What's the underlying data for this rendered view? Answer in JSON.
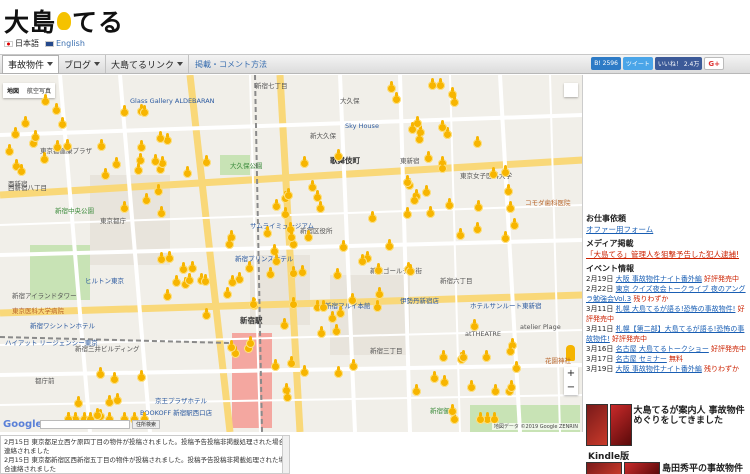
{
  "header": {
    "logo_text_1": "大島",
    "logo_text_2": "てる",
    "lang_ja": "日本語",
    "lang_en": "English"
  },
  "nav": {
    "items": [
      "事故物件",
      "ブログ",
      "大島てるリンク"
    ],
    "link": "掲載・コメント方法",
    "social": {
      "hatena": "B! 2596",
      "tweet": "ツイート",
      "like": "いいね！ 2.4万",
      "gplus": "G+"
    }
  },
  "map": {
    "type_map": "地図",
    "type_sat": "航空写真",
    "google": "Google",
    "attribution": "地図データ ©2019 Google ZENRIN",
    "search_btn": "住所検索",
    "labels": [
      {
        "t": "Glass Gallery ALDEBARAN",
        "c": "blue"
      },
      {
        "t": "西新宿",
        "c": ""
      },
      {
        "t": "東京都庁",
        "c": ""
      },
      {
        "t": "新宿中央公園",
        "c": "green"
      },
      {
        "t": "ヒルトン東京",
        "c": "blue"
      },
      {
        "t": "京王プラザホテル",
        "c": "blue"
      },
      {
        "t": "新宿駅",
        "c": "bold"
      },
      {
        "t": "歌舞伎町",
        "c": "bold"
      },
      {
        "t": "大久保公園",
        "c": "green"
      },
      {
        "t": "新宿区役所",
        "c": ""
      },
      {
        "t": "新宿御苑",
        "c": "green"
      },
      {
        "t": "新宿三丁目",
        "c": ""
      },
      {
        "t": "伊勢丹新宿店",
        "c": "blue"
      },
      {
        "t": "東新宿",
        "c": ""
      },
      {
        "t": "大久保",
        "c": ""
      },
      {
        "t": "新大久保",
        "c": ""
      },
      {
        "t": "Sky House",
        "c": "blue"
      },
      {
        "t": "サムライミュージアム",
        "c": "blue"
      },
      {
        "t": "新宿プリンスホテル",
        "c": "blue"
      },
      {
        "t": "新宿マルイ本館",
        "c": "blue"
      },
      {
        "t": "BOOKOFF 新宿駅西口店",
        "c": "blue"
      },
      {
        "t": "新宿三井ビルディング",
        "c": ""
      },
      {
        "t": "ハイアット リージェンシー東京",
        "c": "blue"
      },
      {
        "t": "都庁前",
        "c": ""
      },
      {
        "t": "新宿ゴールデン街",
        "c": ""
      },
      {
        "t": "新宿七丁目",
        "c": ""
      },
      {
        "t": "新宿六丁目",
        "c": ""
      },
      {
        "t": "花園神社",
        "c": "orange"
      },
      {
        "t": "atTHEATRE",
        "c": ""
      },
      {
        "t": "atelier Plage",
        "c": ""
      },
      {
        "t": "東京医科大学病院",
        "c": "orange"
      },
      {
        "t": "新宿アイランドタワー",
        "c": ""
      },
      {
        "t": "西新宿八丁目",
        "c": ""
      },
      {
        "t": "新宿ワシントンホテル",
        "c": "blue"
      },
      {
        "t": "東京都健康プラザ",
        "c": ""
      },
      {
        "t": "東京女子医科大学",
        "c": ""
      },
      {
        "t": "コモダ歯科医院",
        "c": "orange"
      },
      {
        "t": "ホテルサンルート東新宿",
        "c": "blue"
      }
    ]
  },
  "news": [
    "2月15日 東京都足立西ケ原四丁目の物件が投稿されました。投稿予告投稿非掲載処理された場合連絡されました",
    "2月15日 東京都新宿区西新宿五丁目の物件が投稿されました。投稿予告投稿非掲載処理された場合連絡されました"
  ],
  "sidebar": {
    "h_work": "お仕事依頼",
    "work_link": "オファー用フォーム",
    "h_media": "メディア掲載",
    "media_link": "「大島てる」管理人を狙撃予告した犯人逮捕!",
    "h_events": "イベント情報",
    "events": [
      {
        "d": "2月19日",
        "l": "大阪 事故物件ナイト番外編",
        "s": "好評発売中"
      },
      {
        "d": "2月22日",
        "l": "東京 クイズ夜会トークライブ 夜のアングラ勉強会Vol.3",
        "s": "残りわずか"
      },
      {
        "d": "3月11日",
        "l": "札幌 大島てるが語る!恐怖の事故物件!",
        "s": "好評発売中"
      },
      {
        "d": "3月11日",
        "l": "札幌【第二部】大島てるが語る!恐怖の事故物件!",
        "s": "好評発売中"
      },
      {
        "d": "3月16日",
        "l": "名古屋 大島てるトークショー",
        "s": "好評発売中"
      },
      {
        "d": "3月17日",
        "l": "名古屋 セミナー",
        "s": "無料"
      },
      {
        "d": "3月19日",
        "l": "大阪 事故物件ナイト番外編",
        "s": "残りわずか"
      }
    ],
    "book1": "大島てるが案内人 事故物件めぐりをしてきました",
    "kindle": "Kindle版",
    "book2": "島田秀平の事故物件"
  }
}
